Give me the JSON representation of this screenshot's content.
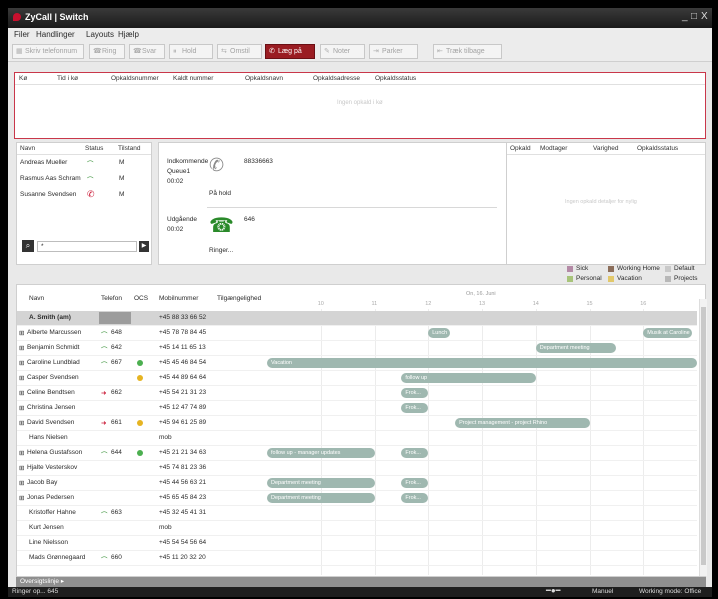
{
  "title": "ZyCall | Switch",
  "window_controls": [
    "_",
    "□",
    "X"
  ],
  "menu": [
    "Filer",
    "Handlinger",
    "Layouts",
    "Hjælp"
  ],
  "toolbar": [
    {
      "label": "Skriv telefonnum",
      "icon": "dialpad-icon"
    },
    {
      "label": "Ring",
      "icon": "phone-icon"
    },
    {
      "label": "Svar",
      "icon": "phone-icon"
    },
    {
      "label": "Hold",
      "icon": "hold-icon"
    },
    {
      "label": "Omstil",
      "icon": "transfer-icon"
    },
    {
      "label": "Læg på",
      "icon": "hangup-icon"
    },
    {
      "label": "Noter",
      "icon": "note-icon"
    },
    {
      "label": "Parker",
      "icon": "park-icon"
    },
    {
      "label": "Træk tilbage",
      "icon": "retrieve-icon"
    }
  ],
  "queue_panel": {
    "headers": [
      "Kø",
      "Tid i kø",
      "Opkaldsnummer",
      "Kaldt nummer",
      "Opkaldsnavn",
      "Opkaldsadresse",
      "Opkaldsstatus"
    ],
    "empty_text": "Ingen opkald i kø"
  },
  "users_panel": {
    "headers": [
      "Navn",
      "Status",
      "Tilstand"
    ],
    "rows": [
      {
        "name": "Andreas Mueller",
        "state": "M",
        "phone": "green"
      },
      {
        "name": "Rasmus Aas Schram",
        "state": "M",
        "phone": "green"
      },
      {
        "name": "Susanne Svendsen",
        "state": "M",
        "phone": "red"
      }
    ],
    "search_value": "*"
  },
  "calls_panel": {
    "incoming_label": "Indkommende",
    "incoming_queue": "Queue1",
    "incoming_time": "00:02",
    "incoming_number": "88336663",
    "incoming_status": "På hold",
    "outgoing_label": "Udgående",
    "outgoing_time": "00:02",
    "outgoing_number": "646",
    "outgoing_status": "Ringer..."
  },
  "history_panel": {
    "headers": [
      "Opkald",
      "Modtager",
      "Varighed",
      "Opkaldsstatus"
    ],
    "empty_text": "Ingen opkald detaljer for nylig"
  },
  "legend": [
    {
      "label": "Sick",
      "color": "#b48aa6"
    },
    {
      "label": "Working Home",
      "color": "#8c6e5a"
    },
    {
      "label": "Default",
      "color": "#c9c9c9"
    },
    {
      "label": "Personal",
      "color": "#a8c47a"
    },
    {
      "label": "Vacation",
      "color": "#e2c86a"
    },
    {
      "label": "Projects",
      "color": "#b8b8b8"
    }
  ],
  "grid": {
    "headers": [
      "Navn",
      "Telefon",
      "OCS",
      "Mobilnummer",
      "Tilgængelighed"
    ],
    "date_label": "On, 16. Juni",
    "hours": [
      "10",
      "11",
      "12",
      "13",
      "14",
      "15",
      "16"
    ],
    "group_row": {
      "name": "A. Smith (am)",
      "mobile": "+45 88 33 66 52"
    },
    "rows": [
      {
        "name": "Alberte Marcussen",
        "exp": true,
        "phone": "648",
        "ph": "green",
        "ocs": "",
        "mobile": "+45 78 78 84 45",
        "bars": [
          {
            "label": "Lunch",
            "h0": 12.0,
            "h1": 12.4
          },
          {
            "label": "Musik at Caroline",
            "h0": 16.0,
            "h1": 16.9
          }
        ]
      },
      {
        "name": "Benjamin Schmidt",
        "exp": true,
        "phone": "642",
        "ph": "green",
        "ocs": "",
        "mobile": "+45 14 11 65 13",
        "bars": [
          {
            "label": "Department meeting",
            "h0": 14.0,
            "h1": 15.5
          }
        ]
      },
      {
        "name": "Caroline Lundblad",
        "exp": true,
        "phone": "667",
        "ph": "green",
        "ocs": "green",
        "mobile": "+45 45 46 84 54",
        "bars": [
          {
            "label": "Vacation",
            "h0": 9.0,
            "h1": 17.0
          }
        ]
      },
      {
        "name": "Casper Svendsen",
        "exp": true,
        "phone": "",
        "ph": "",
        "ocs": "yellow",
        "mobile": "+45 44 89 64 64",
        "bars": [
          {
            "label": "follow up",
            "h0": 11.5,
            "h1": 14.0
          }
        ]
      },
      {
        "name": "Celine Bendtsen",
        "exp": true,
        "phone": "662",
        "ph": "red",
        "ocs": "",
        "mobile": "+45 54 21 31 23",
        "bars": [
          {
            "label": "Frok...",
            "h0": 11.5,
            "h1": 12.0
          }
        ]
      },
      {
        "name": "Christina Jensen",
        "exp": true,
        "phone": "",
        "ph": "",
        "ocs": "",
        "mobile": "+45 12 47 74 89",
        "bars": [
          {
            "label": "Frok...",
            "h0": 11.5,
            "h1": 12.0
          }
        ]
      },
      {
        "name": "David Svendsen",
        "exp": true,
        "phone": "661",
        "ph": "red",
        "ocs": "yellow",
        "mobile": "+45 94 61 25 89",
        "bars": [
          {
            "label": "Project management - project Rhino",
            "h0": 12.5,
            "h1": 15.0
          }
        ]
      },
      {
        "name": "Hans Nielsen",
        "exp": false,
        "phone": "",
        "ph": "",
        "ocs": "",
        "mobile": "mob",
        "bars": []
      },
      {
        "name": "Helena Gustafsson",
        "exp": true,
        "phone": "644",
        "ph": "green",
        "ocs": "green",
        "mobile": "+45 21 21 34 63",
        "bars": [
          {
            "label": "follow up - manager updates",
            "h0": 9.0,
            "h1": 11.0
          },
          {
            "label": "Frok...",
            "h0": 11.5,
            "h1": 12.0
          }
        ]
      },
      {
        "name": "Hjalte Vesterskov",
        "exp": true,
        "phone": "",
        "ph": "",
        "ocs": "",
        "mobile": "+45 74 81 23 36",
        "bars": []
      },
      {
        "name": "Jacob Bay",
        "exp": true,
        "phone": "",
        "ph": "",
        "ocs": "",
        "mobile": "+45 44 56 63 21",
        "bars": [
          {
            "label": "Department meeting",
            "h0": 9.0,
            "h1": 11.0
          },
          {
            "label": "Frok...",
            "h0": 11.5,
            "h1": 12.0
          }
        ]
      },
      {
        "name": "Jonas Pedersen",
        "exp": true,
        "phone": "",
        "ph": "",
        "ocs": "",
        "mobile": "+45 65 45 84 23",
        "bars": [
          {
            "label": "Department meeting",
            "h0": 9.0,
            "h1": 11.0
          },
          {
            "label": "Frok...",
            "h0": 11.5,
            "h1": 12.0
          }
        ]
      },
      {
        "name": "Kristoffer Hahne",
        "exp": false,
        "phone": "663",
        "ph": "green",
        "ocs": "",
        "mobile": "+45 32 45 41 31",
        "bars": []
      },
      {
        "name": "Kurt Jensen",
        "exp": false,
        "phone": "",
        "ph": "",
        "ocs": "",
        "mobile": "mob",
        "bars": []
      },
      {
        "name": "Line Nielsson",
        "exp": false,
        "phone": "",
        "ph": "",
        "ocs": "",
        "mobile": "+45 54 54 56 64",
        "bars": []
      },
      {
        "name": "Mads Grønnegaard",
        "exp": false,
        "phone": "660",
        "ph": "green",
        "ocs": "",
        "mobile": "+45 11 20 32 20",
        "bars": []
      }
    ]
  },
  "overview_label": "Oversigtslinje",
  "status": {
    "left": "Ringer op... 645",
    "mode": "Manuel",
    "working_mode": "Working mode: Office"
  },
  "colors": {
    "accent": "#9a1c22",
    "bar": "#9fb8b0",
    "ok": "#2a8a2a",
    "busy": "#c8102e"
  }
}
